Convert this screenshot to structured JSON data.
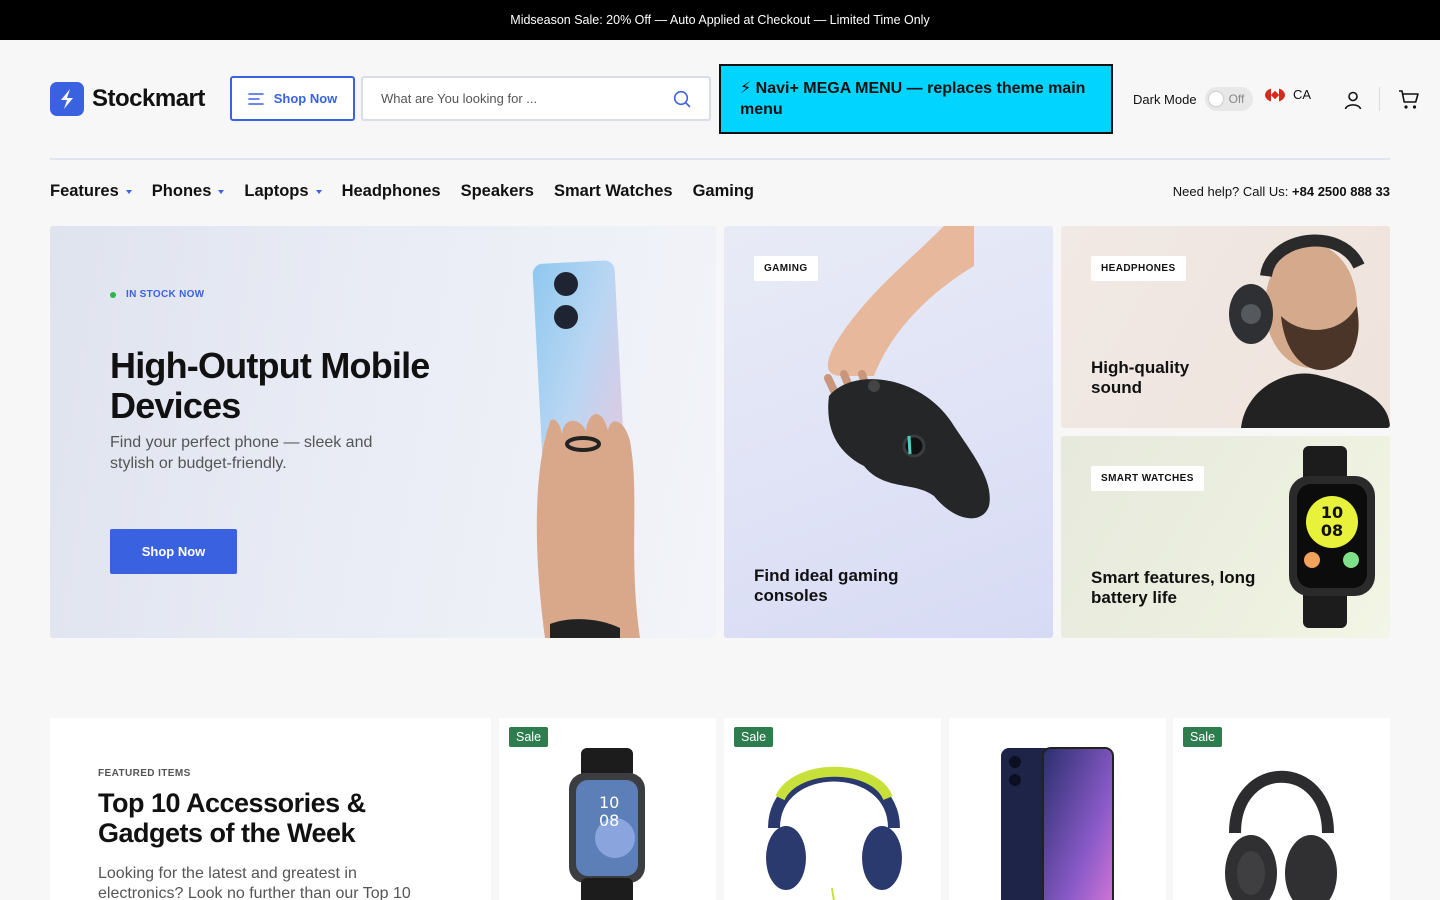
{
  "announcement": "Midseason Sale: 20% Off — Auto Applied at Checkout — Limited Time Only",
  "brand": {
    "name": "Stockmart",
    "accent": "#3a62e0"
  },
  "header": {
    "shop_button": "Shop Now",
    "search_placeholder": "What are You looking for ...",
    "mega_menu_banner": "⚡ Navi+ MEGA MENU — replaces theme main menu",
    "dark_mode_label": "Dark Mode",
    "dark_mode_state": "Off",
    "locale": "CA"
  },
  "nav": {
    "items": [
      {
        "label": "Features",
        "dropdown": true
      },
      {
        "label": "Phones",
        "dropdown": true
      },
      {
        "label": "Laptops",
        "dropdown": true
      },
      {
        "label": "Headphones",
        "dropdown": false
      },
      {
        "label": "Speakers",
        "dropdown": false
      },
      {
        "label": "Smart Watches",
        "dropdown": false
      },
      {
        "label": "Gaming",
        "dropdown": false
      }
    ],
    "help_text": "Need help? Call Us:",
    "help_phone": "+84 2500 888 33"
  },
  "hero": {
    "badge": "IN STOCK NOW",
    "title": "High-Output Mobile Devices",
    "subtitle": "Find your perfect phone — sleek and stylish or budget-friendly.",
    "button": "Shop Now"
  },
  "tiles": [
    {
      "tag": "GAMING",
      "title": "Find ideal gaming consoles"
    },
    {
      "tag": "HEADPHONES",
      "title": "High-quality sound"
    },
    {
      "tag": "SMART WATCHES",
      "title": "Smart features, long battery life"
    }
  ],
  "featured": {
    "label": "FEATURED ITEMS",
    "title": "Top 10 Accessories & Gadgets of the Week",
    "description": "Looking for the latest and greatest in electronics? Look no further than our Top 10"
  },
  "products": [
    {
      "badge": "Sale",
      "icon": "smartwatch"
    },
    {
      "badge": "Sale",
      "icon": "headphones-yellow"
    },
    {
      "badge": "",
      "icon": "smartphone"
    },
    {
      "badge": "Sale",
      "icon": "headphones-black"
    }
  ]
}
